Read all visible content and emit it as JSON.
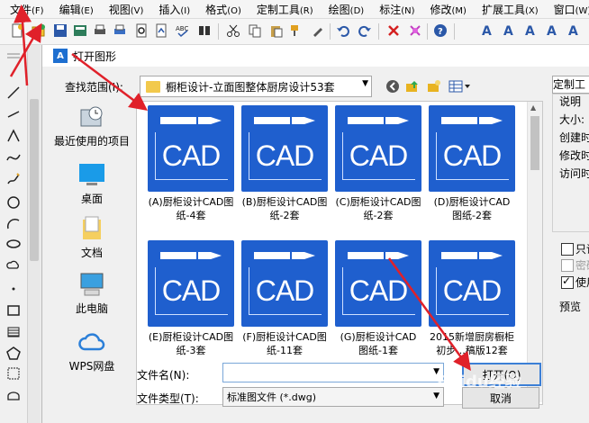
{
  "menu": [
    {
      "label": "文件",
      "hk": "(F)"
    },
    {
      "label": "编辑",
      "hk": "(E)"
    },
    {
      "label": "视图",
      "hk": "(V)"
    },
    {
      "label": "插入",
      "hk": "(I)"
    },
    {
      "label": "格式",
      "hk": "(O)"
    },
    {
      "label": "定制工具",
      "hk": "(R)"
    },
    {
      "label": "绘图",
      "hk": "(D)"
    },
    {
      "label": "标注",
      "hk": "(N)"
    },
    {
      "label": "修改",
      "hk": "(M)"
    },
    {
      "label": "扩展工具",
      "hk": "(X)"
    },
    {
      "label": "窗口",
      "hk": "(W)"
    }
  ],
  "dialog": {
    "title": "打开图形",
    "app_icon": "A",
    "look_in_label": "查找范围(I):",
    "look_in_value": "橱柜设计-立面图整体厨房设计53套"
  },
  "places": [
    {
      "label": "最近使用的项目",
      "icon": "recent-icon"
    },
    {
      "label": "桌面",
      "icon": "desktop-icon"
    },
    {
      "label": "文档",
      "icon": "documents-icon"
    },
    {
      "label": "此电脑",
      "icon": "computer-icon"
    },
    {
      "label": "WPS网盘",
      "icon": "cloud-icon"
    }
  ],
  "thumb_text": "CAD",
  "files": [
    {
      "line1": "(A)厨柜设计CAD图",
      "line2": "纸-4套"
    },
    {
      "line1": "(B)厨柜设计CAD图",
      "line2": "纸-2套"
    },
    {
      "line1": "(C)厨柜设计CAD图",
      "line2": "纸-2套"
    },
    {
      "line1": "(D)厨柜设计CAD",
      "line2": "图纸-2套"
    },
    {
      "line1": "(E)厨柜设计CAD图",
      "line2": "纸-3套"
    },
    {
      "line1": "(F)厨柜设计CAD图",
      "line2": "纸-11套"
    },
    {
      "line1": "(G)厨柜设计CAD",
      "line2": "图纸-1套"
    },
    {
      "line1": "2015新增厨房橱柜",
      "line2": "初步...稿版12套"
    }
  ],
  "right_panel": {
    "tab": "定制工",
    "group_title": "说明",
    "size": "大小:",
    "created": "创建时",
    "modified": "修改时",
    "accessed": "访问时",
    "readonly": "只读",
    "password": "密码",
    "use": "使用",
    "preview": "预览"
  },
  "bottom": {
    "filename_label": "文件名(N):",
    "filename_value": "",
    "filetype_label": "文件类型(T):",
    "filetype_value": "标准图文件 (*.dwg)",
    "open_label": "打开(O)",
    "cancel_label": "取消"
  },
  "watermark": "Baidu经验",
  "colors": {
    "thumb": "#1f5fce",
    "arrow": "#e0212a"
  }
}
